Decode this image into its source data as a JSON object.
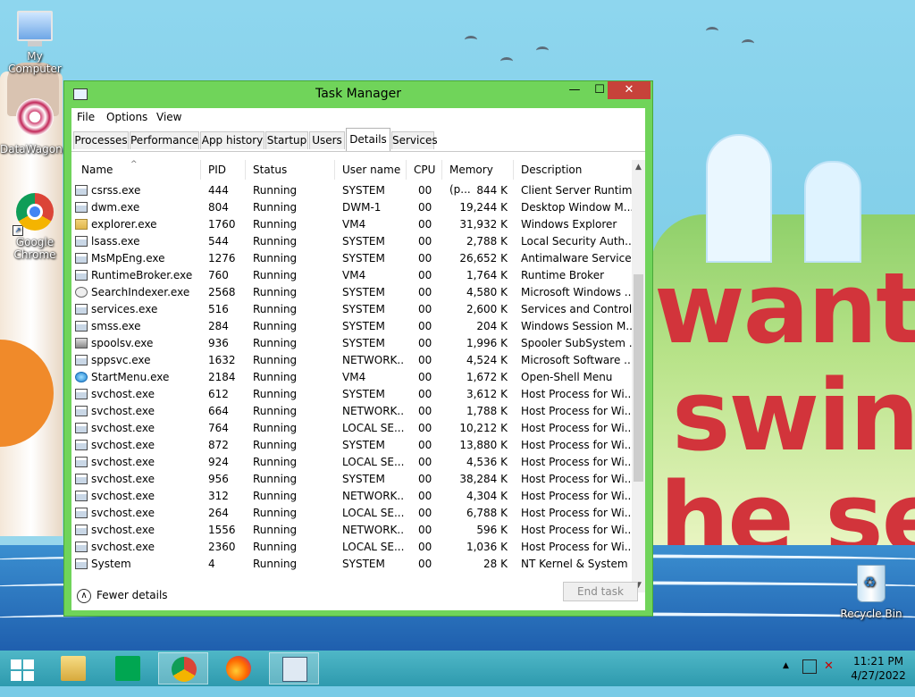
{
  "desktop": {
    "icons": [
      {
        "label": "My Computer"
      },
      {
        "label": "DataWagon..."
      },
      {
        "label": "Google Chrome"
      },
      {
        "label": "Recycle Bin"
      }
    ],
    "wallpaper_text": [
      "want",
      "swin",
      "he se"
    ]
  },
  "window": {
    "title": "Task Manager",
    "controls": {
      "minimize": "—",
      "maximize": "☐",
      "close": "✕"
    },
    "menu": [
      "File",
      "Options",
      "View"
    ],
    "tabs": [
      "Processes",
      "Performance",
      "App history",
      "Startup",
      "Users",
      "Details",
      "Services"
    ],
    "active_tab": "Details",
    "columns": [
      "Name",
      "PID",
      "Status",
      "User name",
      "CPU",
      "Memory (p...",
      "Description"
    ],
    "sort_indicator": "^",
    "rows": [
      {
        "name": "csrss.exe",
        "pid": "444",
        "status": "Running",
        "user": "SYSTEM",
        "cpu": "00",
        "mem": "844 K",
        "desc": "Client Server Runtim...",
        "icon": "generic"
      },
      {
        "name": "dwm.exe",
        "pid": "804",
        "status": "Running",
        "user": "DWM-1",
        "cpu": "00",
        "mem": "19,244 K",
        "desc": "Desktop Window M...",
        "icon": "generic"
      },
      {
        "name": "explorer.exe",
        "pid": "1760",
        "status": "Running",
        "user": "VM4",
        "cpu": "00",
        "mem": "31,932 K",
        "desc": "Windows Explorer",
        "icon": "folder"
      },
      {
        "name": "lsass.exe",
        "pid": "544",
        "status": "Running",
        "user": "SYSTEM",
        "cpu": "00",
        "mem": "2,788 K",
        "desc": "Local Security Auth...",
        "icon": "generic"
      },
      {
        "name": "MsMpEng.exe",
        "pid": "1276",
        "status": "Running",
        "user": "SYSTEM",
        "cpu": "00",
        "mem": "26,652 K",
        "desc": "Antimalware Service...",
        "icon": "generic"
      },
      {
        "name": "RuntimeBroker.exe",
        "pid": "760",
        "status": "Running",
        "user": "VM4",
        "cpu": "00",
        "mem": "1,764 K",
        "desc": "Runtime Broker",
        "icon": "generic"
      },
      {
        "name": "SearchIndexer.exe",
        "pid": "2568",
        "status": "Running",
        "user": "SYSTEM",
        "cpu": "00",
        "mem": "4,580 K",
        "desc": "Microsoft Windows ...",
        "icon": "search"
      },
      {
        "name": "services.exe",
        "pid": "516",
        "status": "Running",
        "user": "SYSTEM",
        "cpu": "00",
        "mem": "2,600 K",
        "desc": "Services and Control...",
        "icon": "generic"
      },
      {
        "name": "smss.exe",
        "pid": "284",
        "status": "Running",
        "user": "SYSTEM",
        "cpu": "00",
        "mem": "204 K",
        "desc": "Windows Session M...",
        "icon": "generic"
      },
      {
        "name": "spoolsv.exe",
        "pid": "936",
        "status": "Running",
        "user": "SYSTEM",
        "cpu": "00",
        "mem": "1,996 K",
        "desc": "Spooler SubSystem ...",
        "icon": "printer"
      },
      {
        "name": "sppsvc.exe",
        "pid": "1632",
        "status": "Running",
        "user": "NETWORK...",
        "cpu": "00",
        "mem": "4,524 K",
        "desc": "Microsoft Software ...",
        "icon": "generic"
      },
      {
        "name": "StartMenu.exe",
        "pid": "2184",
        "status": "Running",
        "user": "VM4",
        "cpu": "00",
        "mem": "1,672 K",
        "desc": "Open-Shell Menu",
        "icon": "start"
      },
      {
        "name": "svchost.exe",
        "pid": "612",
        "status": "Running",
        "user": "SYSTEM",
        "cpu": "00",
        "mem": "3,612 K",
        "desc": "Host Process for Wi...",
        "icon": "generic"
      },
      {
        "name": "svchost.exe",
        "pid": "664",
        "status": "Running",
        "user": "NETWORK...",
        "cpu": "00",
        "mem": "1,788 K",
        "desc": "Host Process for Wi...",
        "icon": "generic"
      },
      {
        "name": "svchost.exe",
        "pid": "764",
        "status": "Running",
        "user": "LOCAL SE...",
        "cpu": "00",
        "mem": "10,212 K",
        "desc": "Host Process for Wi...",
        "icon": "generic"
      },
      {
        "name": "svchost.exe",
        "pid": "872",
        "status": "Running",
        "user": "SYSTEM",
        "cpu": "00",
        "mem": "13,880 K",
        "desc": "Host Process for Wi...",
        "icon": "generic"
      },
      {
        "name": "svchost.exe",
        "pid": "924",
        "status": "Running",
        "user": "LOCAL SE...",
        "cpu": "00",
        "mem": "4,536 K",
        "desc": "Host Process for Wi...",
        "icon": "generic"
      },
      {
        "name": "svchost.exe",
        "pid": "956",
        "status": "Running",
        "user": "SYSTEM",
        "cpu": "00",
        "mem": "38,284 K",
        "desc": "Host Process for Wi...",
        "icon": "generic"
      },
      {
        "name": "svchost.exe",
        "pid": "312",
        "status": "Running",
        "user": "NETWORK...",
        "cpu": "00",
        "mem": "4,304 K",
        "desc": "Host Process for Wi...",
        "icon": "generic"
      },
      {
        "name": "svchost.exe",
        "pid": "264",
        "status": "Running",
        "user": "LOCAL SE...",
        "cpu": "00",
        "mem": "6,788 K",
        "desc": "Host Process for Wi...",
        "icon": "generic"
      },
      {
        "name": "svchost.exe",
        "pid": "1556",
        "status": "Running",
        "user": "NETWORK...",
        "cpu": "00",
        "mem": "596 K",
        "desc": "Host Process for Wi...",
        "icon": "generic"
      },
      {
        "name": "svchost.exe",
        "pid": "2360",
        "status": "Running",
        "user": "LOCAL SE...",
        "cpu": "00",
        "mem": "1,036 K",
        "desc": "Host Process for Wi...",
        "icon": "generic"
      },
      {
        "name": "System",
        "pid": "4",
        "status": "Running",
        "user": "SYSTEM",
        "cpu": "00",
        "mem": "28 K",
        "desc": "NT Kernel & System",
        "icon": "generic"
      }
    ],
    "footer": {
      "fewer_details": "Fewer details",
      "end_task": "End task"
    }
  },
  "taskbar": {
    "items": [
      "start-icon",
      "file-explorer-icon",
      "store-icon",
      "chrome-icon",
      "firefox-icon",
      "task-manager-icon"
    ],
    "active_item": "task-manager-icon",
    "tray_arrow": "▲",
    "clock": {
      "time": "11:21 PM",
      "date": "4/27/2022"
    }
  }
}
